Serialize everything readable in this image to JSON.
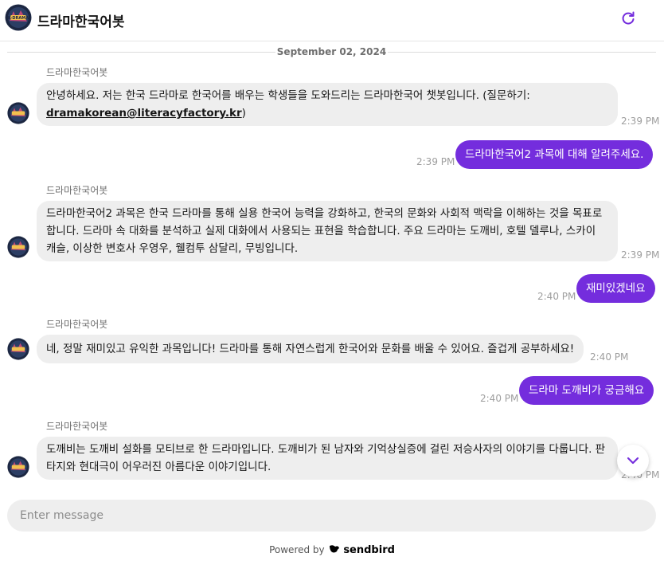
{
  "header": {
    "title": "드라마한국어봇",
    "avatar_icon": "kdrama-logo-icon",
    "refresh_icon": "refresh-icon",
    "accent_color": "#742ddd"
  },
  "date_separator": "September 02, 2024",
  "messages": [
    {
      "from": "bot",
      "sender": "드라마한국어봇",
      "text_before": "안녕하세요. 저는 한국 드라마로 한국어를 배우는 학생들을 도와드리는 드라마한국어 챗봇입니다. (질문하기: ",
      "link": "dramakorean@literacyfactory.kr",
      "text_after": ")",
      "time": "2:39 PM"
    },
    {
      "from": "user",
      "text": "드라마한국어2 과목에 대해 알려주세요.",
      "time": "2:39 PM"
    },
    {
      "from": "bot",
      "sender": "드라마한국어봇",
      "text": "드라마한국어2 과목은 한국 드라마를 통해 실용 한국어 능력을 강화하고, 한국의 문화와 사회적 맥락을 이해하는 것을 목표로 합니다. 드라마 속 대화를 분석하고 실제 대화에서 사용되는 표현을 학습합니다. 주요 드라마는 도깨비, 호텔 델루나, 스카이 캐슬, 이상한 변호사 우영우, 웰컴투 삼달리, 무빙입니다.",
      "time": "2:39 PM"
    },
    {
      "from": "user",
      "text": "재미있겠네요",
      "time": "2:40 PM"
    },
    {
      "from": "bot",
      "sender": "드라마한국어봇",
      "text": "네, 정말 재미있고 유익한 과목입니다! 드라마를 통해 자연스럽게 한국어와 문화를 배울 수 있어요. 즐겁게 공부하세요!",
      "time": "2:40 PM"
    },
    {
      "from": "user",
      "text": "드라마 도깨비가 궁금해요",
      "time": "2:40 PM"
    },
    {
      "from": "bot",
      "sender": "드라마한국어봇",
      "text": "도깨비는 도깨비 설화를 모티브로 한 드라마입니다. 도깨비가 된 남자와 기억상실증에 걸린 저승사자의 이야기를 다룹니다. 판타지와 현대극이 어우러진 아름다운 이야기입니다.",
      "time": "2:40 PM"
    }
  ],
  "scroll_button_icon": "chevron-down-icon",
  "composer": {
    "placeholder": "Enter message",
    "value": ""
  },
  "footer": {
    "powered_by": "Powered by",
    "brand": "sendbird",
    "brand_icon": "sendbird-logo-icon"
  }
}
